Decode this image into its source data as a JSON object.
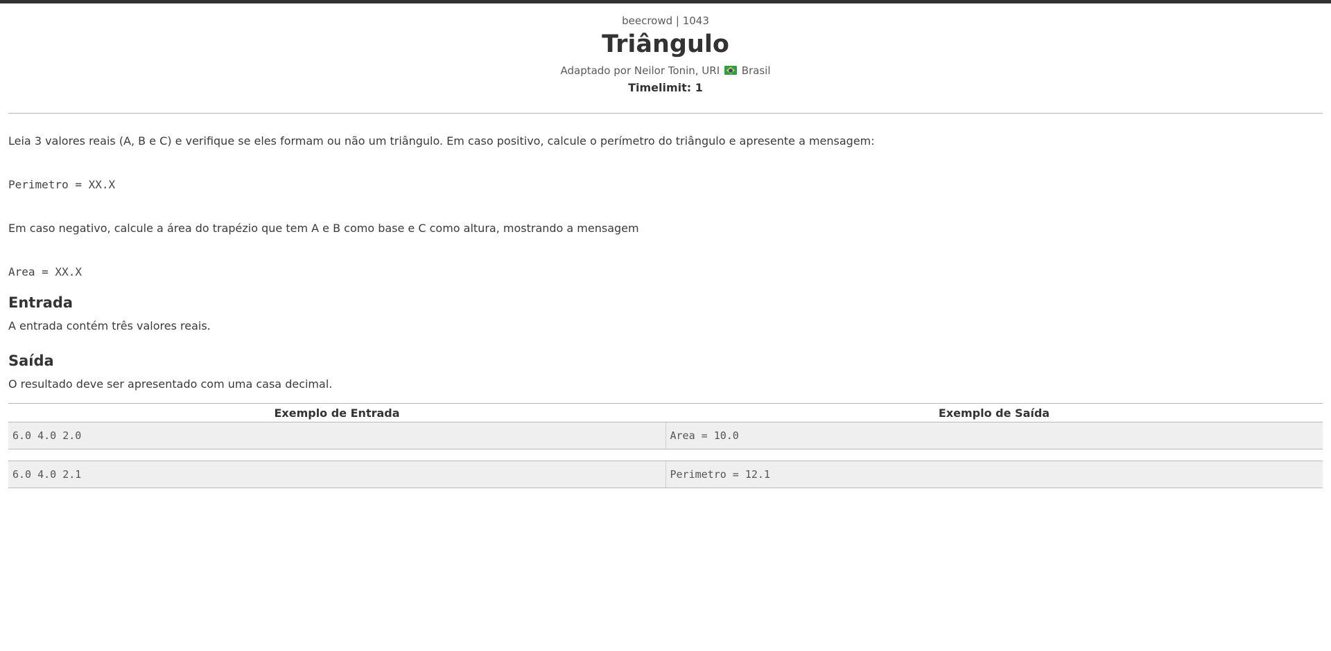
{
  "header": {
    "site": "beecrowd | 1043",
    "title": "Triângulo",
    "author_prefix": "Adaptado por Neilor Tonin, URI",
    "country": "Brasil",
    "timelimit": "Timelimit: 1"
  },
  "description": {
    "paragraph1": "Leia 3 valores reais (A, B e C) e verifique se eles formam ou não um triângulo. Em caso positivo, calcule o perímetro do triângulo e apresente a mensagem:",
    "code1": "Perimetro = XX.X",
    "paragraph2": "Em caso negativo, calcule a área do trapézio que tem A e B como base e C como altura, mostrando a mensagem",
    "code2": "Area = XX.X"
  },
  "input_section": {
    "title": "Entrada",
    "text": "A entrada contém três valores reais."
  },
  "output_section": {
    "title": "Saída",
    "text": "O resultado deve ser apresentado com uma casa decimal."
  },
  "samples": {
    "input_header": "Exemplo de Entrada",
    "output_header": "Exemplo de Saída",
    "rows": [
      {
        "input": "6.0 4.0 2.0",
        "output": "Area = 10.0"
      },
      {
        "input": "6.0 4.0 2.1",
        "output": "Perimetro = 12.1"
      }
    ]
  },
  "colors": {
    "top_bar": "#333333",
    "sample_bg": "#efefef",
    "flag_green": "#2aa149",
    "flag_yellow": "#f4d11a",
    "flag_blue": "#2b4a9e"
  }
}
